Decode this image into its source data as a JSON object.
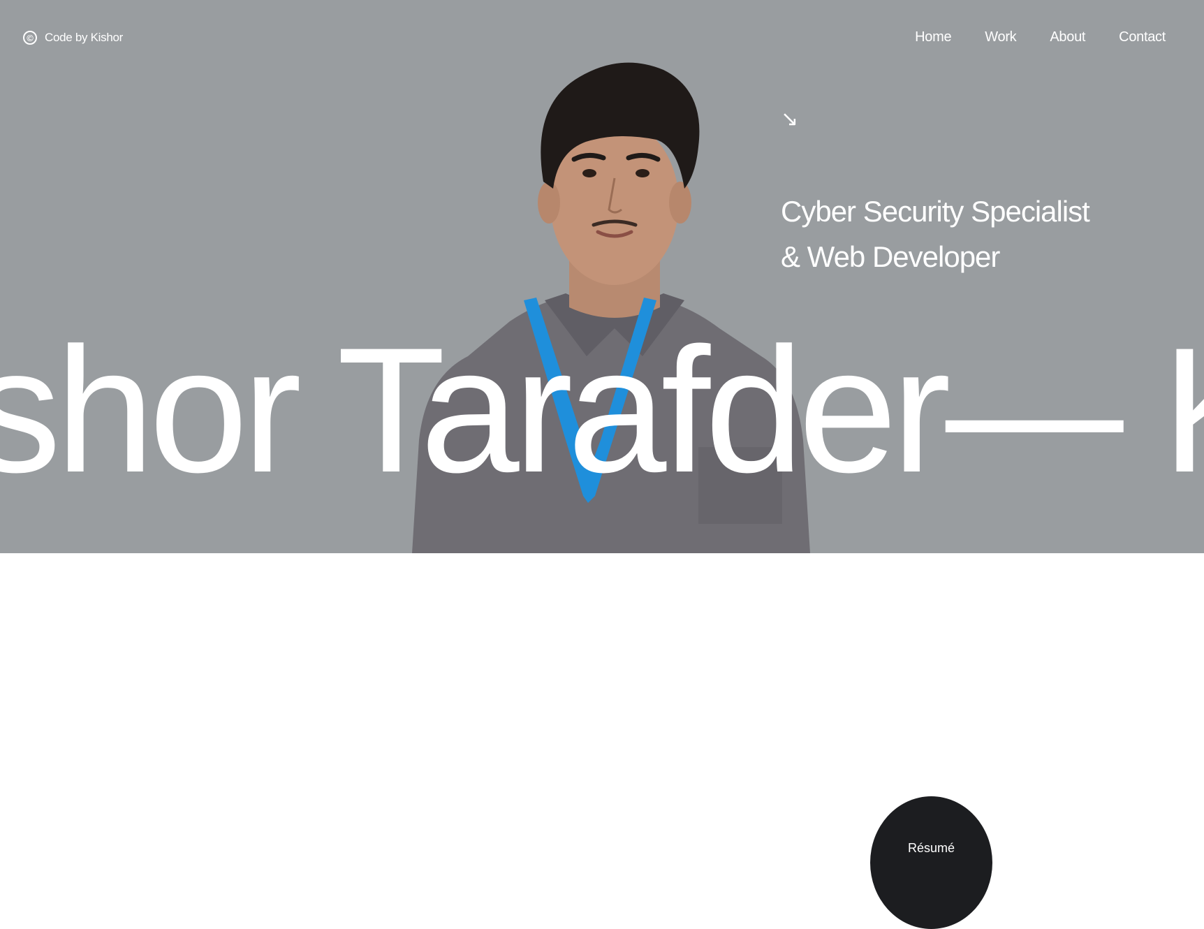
{
  "header": {
    "brand_icon": "©",
    "brand_label": "Code by Kishor",
    "nav": [
      {
        "label": "Home"
      },
      {
        "label": "Work"
      },
      {
        "label": "About"
      },
      {
        "label": "Contact"
      }
    ]
  },
  "hero": {
    "arrow_icon": "↘",
    "tagline_line1": "Cyber Security Specialist",
    "tagline_line2": "& Web Developer",
    "marquee_text": "shor Tarafder— K",
    "colors": {
      "background": "#999da0",
      "text": "#ffffff"
    }
  },
  "resume": {
    "label": "Résumé",
    "color": "#1c1d20"
  }
}
